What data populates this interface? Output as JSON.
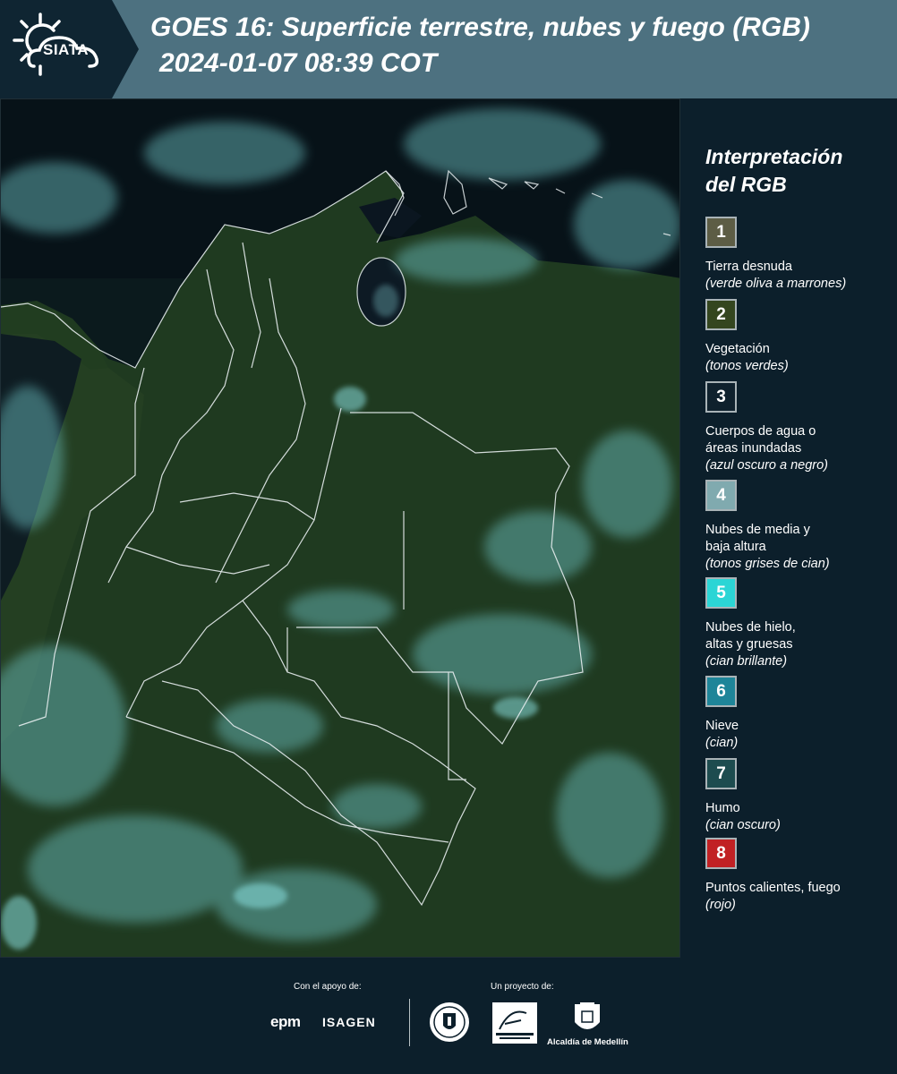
{
  "header": {
    "brand": "SIATA",
    "title_line1": "GOES 16: Superficie terrestre, nubes y fuego (RGB)",
    "title_line2": "2024-01-07 08:39 COT"
  },
  "legend": {
    "title_line1": "Interpretación",
    "title_line2": "del RGB",
    "items": [
      {
        "number": "1",
        "color": "#5d5d45",
        "label_lines": [
          "Tierra desnuda"
        ],
        "desc": "(verde oliva a marrones)"
      },
      {
        "number": "2",
        "color": "#34461f",
        "label_lines": [
          "Vegetación"
        ],
        "desc": "(tonos verdes)"
      },
      {
        "number": "3",
        "color": "#0f212d",
        "label_lines": [
          "Cuerpos de agua o",
          "áreas inundadas"
        ],
        "desc": "(azul oscuro a negro)"
      },
      {
        "number": "4",
        "color": "#80aaaf",
        "label_lines": [
          "Nubes de media y",
          "baja altura"
        ],
        "desc": "(tonos grises de cian)"
      },
      {
        "number": "5",
        "color": "#2bd5d5",
        "label_lines": [
          "Nubes de hielo,",
          "altas y gruesas"
        ],
        "desc": "(cian brillante)"
      },
      {
        "number": "6",
        "color": "#1e8599",
        "label_lines": [
          "Nieve"
        ],
        "desc": "(cian)"
      },
      {
        "number": "7",
        "color": "#1d4c4f",
        "label_lines": [
          "Humo"
        ],
        "desc": "(cian oscuro)"
      },
      {
        "number": "8",
        "color": "#c12124",
        "label_lines": [
          "Puntos calientes, fuego"
        ],
        "desc": "(rojo)"
      }
    ]
  },
  "footer": {
    "apoyo_label": "Con el apoyo de:",
    "proyecto_label": "Un proyecto de:",
    "epm_logo": "epm",
    "isagen_logo": "ISAGEN",
    "medellin_text": "Alcaldía de Medellín"
  },
  "colors": {
    "header_bg": "#4d7180",
    "panel_bg": "#0c1f2b",
    "vegetation": "#1f3a20",
    "ocean": "#0b1a1d",
    "cloud_cyan": "#6fc6c8"
  }
}
